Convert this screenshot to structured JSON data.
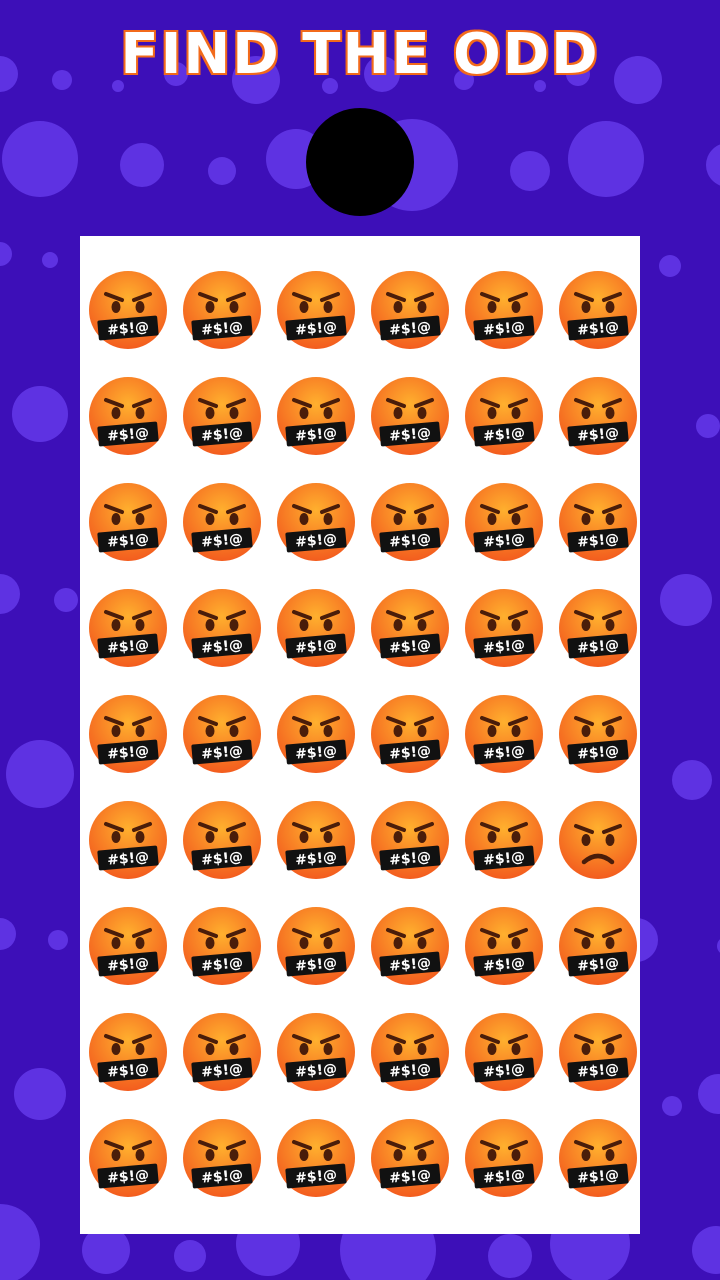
{
  "title": "FIND THE ODD",
  "colors": {
    "background": "#3d0fb8",
    "bubble": "#6a3ff0",
    "board": "#ffffff",
    "title_fill": "#ffffff",
    "title_outline": "#f26a1b",
    "face_top": "#ffb02e",
    "face_bottom": "#f2561d",
    "features": "#4a1d0a",
    "censor_bar": "#111111"
  },
  "grid": {
    "rows": 9,
    "cols": 6,
    "common_icon": "face-with-symbols-on-mouth-icon",
    "odd_icon": "angry-face-icon",
    "odd_position": {
      "row": 6,
      "col": 6
    },
    "symbols": "#$!@"
  }
}
